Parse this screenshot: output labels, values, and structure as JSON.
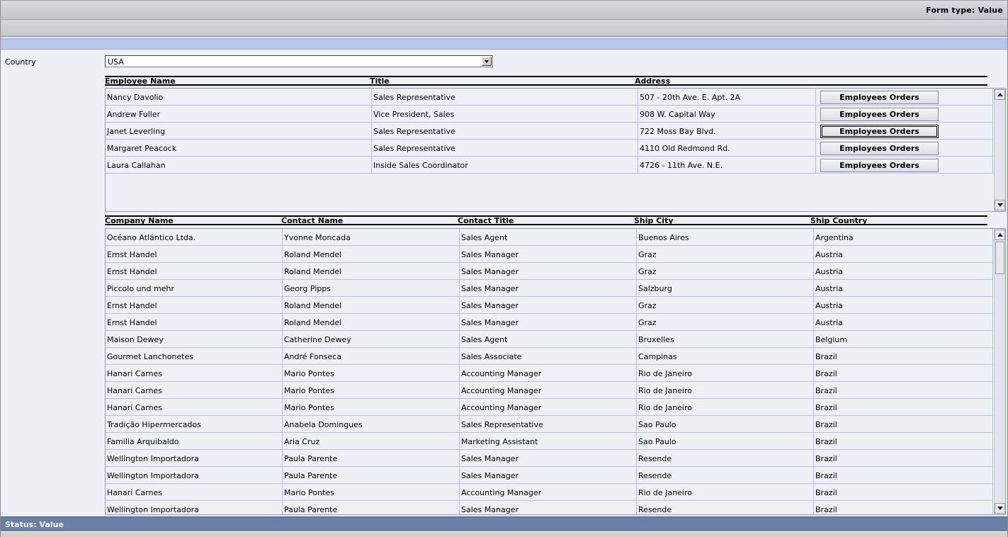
{
  "header": {
    "form_type": "Form type: Value"
  },
  "filter": {
    "label": "Country",
    "selected": "USA"
  },
  "employees": {
    "columns": [
      "Employee Name",
      "Title",
      "Address"
    ],
    "button_label": "Employees Orders",
    "rows": [
      [
        "Nancy Davolio",
        "Sales Representative",
        "507 - 20th Ave. E. Apt. 2A"
      ],
      [
        "Andrew Fuller",
        "Vice President, Sales",
        "908 W. Capital Way"
      ],
      [
        "Janet Leverling",
        "Sales Representative",
        "722 Moss Bay Blvd."
      ],
      [
        "Margaret Peacock",
        "Sales Representative",
        "4110 Old Redmond Rd."
      ],
      [
        "Laura Callahan",
        "Inside Sales Coordinator",
        "4726 - 11th Ave. N.E."
      ]
    ]
  },
  "orders": {
    "columns": [
      "Company Name",
      "Contact Name",
      "Contact Title",
      "Ship City",
      "Ship Country"
    ],
    "rows": [
      [
        "Océano Atlántico Ltda.",
        "Yvonne Moncada",
        "Sales Agent",
        "Buenos Aires",
        "Argentina"
      ],
      [
        "Ernst Handel",
        "Roland Mendel",
        "Sales Manager",
        "Graz",
        "Austria"
      ],
      [
        "Ernst Handel",
        "Roland Mendel",
        "Sales Manager",
        "Graz",
        "Austria"
      ],
      [
        "Piccolo und mehr",
        "Georg Pipps",
        "Sales Manager",
        "Salzburg",
        "Austria"
      ],
      [
        "Ernst Handel",
        "Roland Mendel",
        "Sales Manager",
        "Graz",
        "Austria"
      ],
      [
        "Ernst Handel",
        "Roland Mendel",
        "Sales Manager",
        "Graz",
        "Austria"
      ],
      [
        "Maison Dewey",
        "Catherine Dewey",
        "Sales Agent",
        "Bruxelles",
        "Belgium"
      ],
      [
        "Gourmet Lanchonetes",
        "André Fonseca",
        "Sales Associate",
        "Campinas",
        "Brazil"
      ],
      [
        "Hanari Carnes",
        "Mario Pontes",
        "Accounting Manager",
        "Rio de Janeiro",
        "Brazil"
      ],
      [
        "Hanari Carnes",
        "Mario Pontes",
        "Accounting Manager",
        "Rio de Janeiro",
        "Brazil"
      ],
      [
        "Hanari Carnes",
        "Mario Pontes",
        "Accounting Manager",
        "Rio de Janeiro",
        "Brazil"
      ],
      [
        "Tradição Hipermercados",
        "Anabela Domingues",
        "Sales Representative",
        "Sao Paulo",
        "Brazil"
      ],
      [
        "Familia Arquibaldo",
        "Aria Cruz",
        "Marketing Assistant",
        "Sao Paulo",
        "Brazil"
      ],
      [
        "Wellington Importadora",
        "Paula Parente",
        "Sales Manager",
        "Resende",
        "Brazil"
      ],
      [
        "Wellington Importadora",
        "Paula Parente",
        "Sales Manager",
        "Resende",
        "Brazil"
      ],
      [
        "Hanari Carnes",
        "Mario Pontes",
        "Accounting Manager",
        "Rio de Janeiro",
        "Brazil"
      ],
      [
        "Wellington Importadora",
        "Paula Parente",
        "Sales Manager",
        "Resende",
        "Brazil"
      ]
    ]
  },
  "status": {
    "text": "Status: Value"
  }
}
